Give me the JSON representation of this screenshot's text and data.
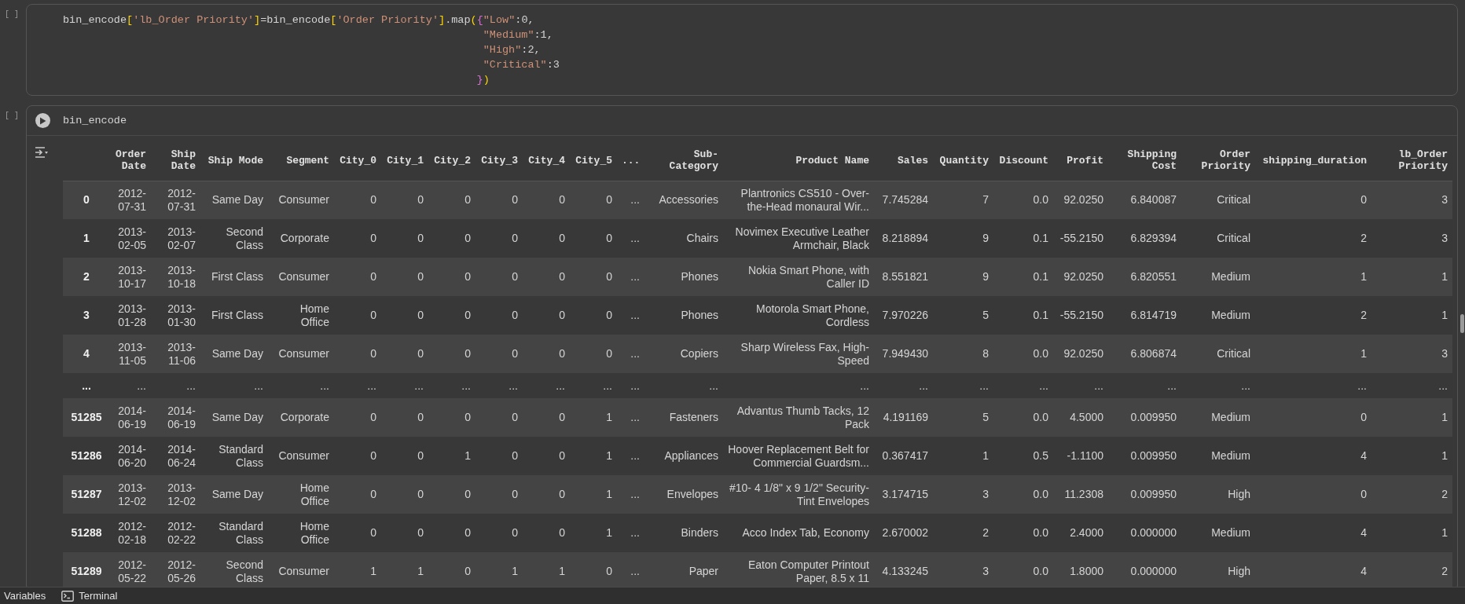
{
  "cells": [
    {
      "bracket": "[ ]",
      "focused": false,
      "code_lines": [
        [
          {
            "kind": "plain",
            "text": "bin_encode"
          },
          {
            "kind": "bracket",
            "text": "["
          },
          {
            "kind": "string",
            "text": "'lb_Order Priority'"
          },
          {
            "kind": "bracket",
            "text": "]"
          },
          {
            "kind": "plain",
            "text": "=bin_encode"
          },
          {
            "kind": "bracket",
            "text": "["
          },
          {
            "kind": "string",
            "text": "'Order Priority'"
          },
          {
            "kind": "bracket",
            "text": "]"
          },
          {
            "kind": "plain",
            "text": ".map"
          },
          {
            "kind": "bracket",
            "text": "("
          },
          {
            "kind": "brace",
            "text": "{"
          },
          {
            "kind": "string",
            "text": "\"Low\""
          },
          {
            "kind": "plain",
            "text": ":0,"
          }
        ],
        [
          {
            "kind": "string",
            "text": "                                                                  \"Medium\""
          },
          {
            "kind": "plain",
            "text": ":1,"
          }
        ],
        [
          {
            "kind": "string",
            "text": "                                                                  \"High\""
          },
          {
            "kind": "plain",
            "text": ":2,"
          }
        ],
        [
          {
            "kind": "string",
            "text": "                                                                  \"Critical\""
          },
          {
            "kind": "plain",
            "text": ":3"
          }
        ],
        [
          {
            "kind": "brace",
            "text": "                                                                 }"
          },
          {
            "kind": "bracket",
            "text": ")"
          }
        ]
      ]
    },
    {
      "bracket": "[ ]",
      "focused": true,
      "code_lines": [
        [
          {
            "kind": "plain",
            "text": "bin_encode"
          }
        ]
      ],
      "output": {
        "table": {
          "columns": [
            "Order Date",
            "Ship Date",
            "Ship Mode",
            "Segment",
            "City_0",
            "City_1",
            "City_2",
            "City_3",
            "City_4",
            "City_5",
            "...",
            "Sub-Category",
            "Product Name",
            "Sales",
            "Quantity",
            "Discount",
            "Profit",
            "Shipping Cost",
            "Order Priority",
            "shipping_duration",
            "lb_Order Priority"
          ],
          "rows": [
            {
              "index": "0",
              "cells": [
                "2012-07-31",
                "2012-07-31",
                "Same Day",
                "Consumer",
                "0",
                "0",
                "0",
                "0",
                "0",
                "0",
                "...",
                "Accessories",
                "Plantronics CS510 - Over-the-Head monaural Wir...",
                "7.745284",
                "7",
                "0.0",
                "92.0250",
                "6.840087",
                "Critical",
                "0",
                "3"
              ]
            },
            {
              "index": "1",
              "cells": [
                "2013-02-05",
                "2013-02-07",
                "Second Class",
                "Corporate",
                "0",
                "0",
                "0",
                "0",
                "0",
                "0",
                "...",
                "Chairs",
                "Novimex Executive Leather Armchair, Black",
                "8.218894",
                "9",
                "0.1",
                "-55.2150",
                "6.829394",
                "Critical",
                "2",
                "3"
              ]
            },
            {
              "index": "2",
              "cells": [
                "2013-10-17",
                "2013-10-18",
                "First Class",
                "Consumer",
                "0",
                "0",
                "0",
                "0",
                "0",
                "0",
                "...",
                "Phones",
                "Nokia Smart Phone, with Caller ID",
                "8.551821",
                "9",
                "0.1",
                "92.0250",
                "6.820551",
                "Medium",
                "1",
                "1"
              ]
            },
            {
              "index": "3",
              "cells": [
                "2013-01-28",
                "2013-01-30",
                "First Class",
                "Home Office",
                "0",
                "0",
                "0",
                "0",
                "0",
                "0",
                "...",
                "Phones",
                "Motorola Smart Phone, Cordless",
                "7.970226",
                "5",
                "0.1",
                "-55.2150",
                "6.814719",
                "Medium",
                "2",
                "1"
              ]
            },
            {
              "index": "4",
              "cells": [
                "2013-11-05",
                "2013-11-06",
                "Same Day",
                "Consumer",
                "0",
                "0",
                "0",
                "0",
                "0",
                "0",
                "...",
                "Copiers",
                "Sharp Wireless Fax, High-Speed",
                "7.949430",
                "8",
                "0.0",
                "92.0250",
                "6.806874",
                "Critical",
                "1",
                "3"
              ]
            },
            {
              "index": "...",
              "cells": [
                "...",
                "...",
                "...",
                "...",
                "...",
                "...",
                "...",
                "...",
                "...",
                "...",
                "...",
                "...",
                "...",
                "...",
                "...",
                "...",
                "...",
                "...",
                "...",
                "...",
                "..."
              ]
            },
            {
              "index": "51285",
              "cells": [
                "2014-06-19",
                "2014-06-19",
                "Same Day",
                "Corporate",
                "0",
                "0",
                "0",
                "0",
                "0",
                "1",
                "...",
                "Fasteners",
                "Advantus Thumb Tacks, 12 Pack",
                "4.191169",
                "5",
                "0.0",
                "4.5000",
                "0.009950",
                "Medium",
                "0",
                "1"
              ]
            },
            {
              "index": "51286",
              "cells": [
                "2014-06-20",
                "2014-06-24",
                "Standard Class",
                "Consumer",
                "0",
                "0",
                "1",
                "0",
                "0",
                "1",
                "...",
                "Appliances",
                "Hoover Replacement Belt for Commercial Guardsm...",
                "0.367417",
                "1",
                "0.5",
                "-1.1100",
                "0.009950",
                "Medium",
                "4",
                "1"
              ]
            },
            {
              "index": "51287",
              "cells": [
                "2013-12-02",
                "2013-12-02",
                "Same Day",
                "Home Office",
                "0",
                "0",
                "0",
                "0",
                "0",
                "1",
                "...",
                "Envelopes",
                "#10- 4 1/8\" x 9 1/2\" Security-Tint Envelopes",
                "3.174715",
                "3",
                "0.0",
                "11.2308",
                "0.009950",
                "High",
                "0",
                "2"
              ]
            },
            {
              "index": "51288",
              "cells": [
                "2012-02-18",
                "2012-02-22",
                "Standard Class",
                "Home Office",
                "0",
                "0",
                "0",
                "0",
                "0",
                "1",
                "...",
                "Binders",
                "Acco Index Tab, Economy",
                "2.670002",
                "2",
                "0.0",
                "2.4000",
                "0.000000",
                "Medium",
                "4",
                "1"
              ]
            },
            {
              "index": "51289",
              "cells": [
                "2012-05-22",
                "2012-05-26",
                "Second Class",
                "Consumer",
                "1",
                "1",
                "0",
                "1",
                "1",
                "0",
                "...",
                "Paper",
                "Eaton Computer Printout Paper, 8.5 x 11",
                "4.133245",
                "3",
                "0.0",
                "1.8000",
                "0.000000",
                "High",
                "4",
                "2"
              ]
            }
          ]
        }
      }
    }
  ],
  "bottom_bar": [
    {
      "kind": "text",
      "label": "Variables"
    },
    {
      "kind": "terminal",
      "label": "Terminal"
    }
  ]
}
